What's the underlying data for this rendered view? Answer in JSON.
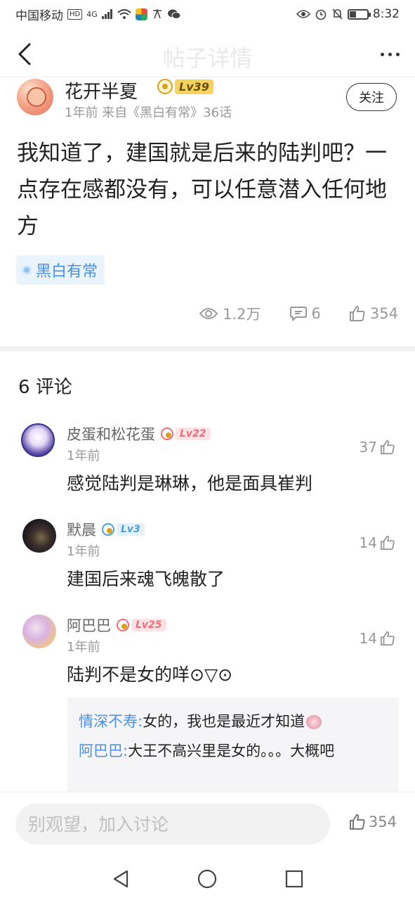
{
  "status_bar": {
    "carrier": "中国移动",
    "hd": "HD",
    "net": "4G",
    "time": "8:32"
  },
  "header": {
    "title": "帖子详情"
  },
  "author": {
    "name": "花开半夏",
    "level": "Lv39",
    "meta": "1年前 来自《黑白有常》36话",
    "follow_label": "关注"
  },
  "post": {
    "text": "我知道了，建国就是后来的陆判吧？一点存在感都没有，可以任意潜入任何地方",
    "tag": "黑白有常",
    "views": "1.2万",
    "comments": "6",
    "likes": "354"
  },
  "comments_section": {
    "title": "6 评论",
    "items": [
      {
        "name": "皮蛋和松花蛋",
        "level": "Lv22",
        "time": "1年前",
        "likes": "37",
        "text": "感觉陆判是琳琳，他是面具崔判"
      },
      {
        "name": "默晨",
        "level": "Lv3",
        "time": "1年前",
        "likes": "14",
        "text": "建国后来魂飞魄散了"
      },
      {
        "name": "阿巴巴",
        "level": "Lv25",
        "time": "1年前",
        "likes": "14",
        "text": "陆判不是女的咩⊙▽⊙"
      }
    ],
    "replies": [
      {
        "author": "情深不寿:",
        "text": "女的，我也是最近才知道"
      },
      {
        "author": "阿巴巴:",
        "text": "大王不高兴里是女的。。。大概吧"
      }
    ]
  },
  "bottom": {
    "placeholder": "别观望，加入讨论",
    "likes": "354"
  },
  "colors": {
    "accent_blue": "#4a90e2",
    "level_gold": "#f4d35e",
    "level_pink": "#ef6c7a",
    "level_blue": "#4aa0d9"
  }
}
